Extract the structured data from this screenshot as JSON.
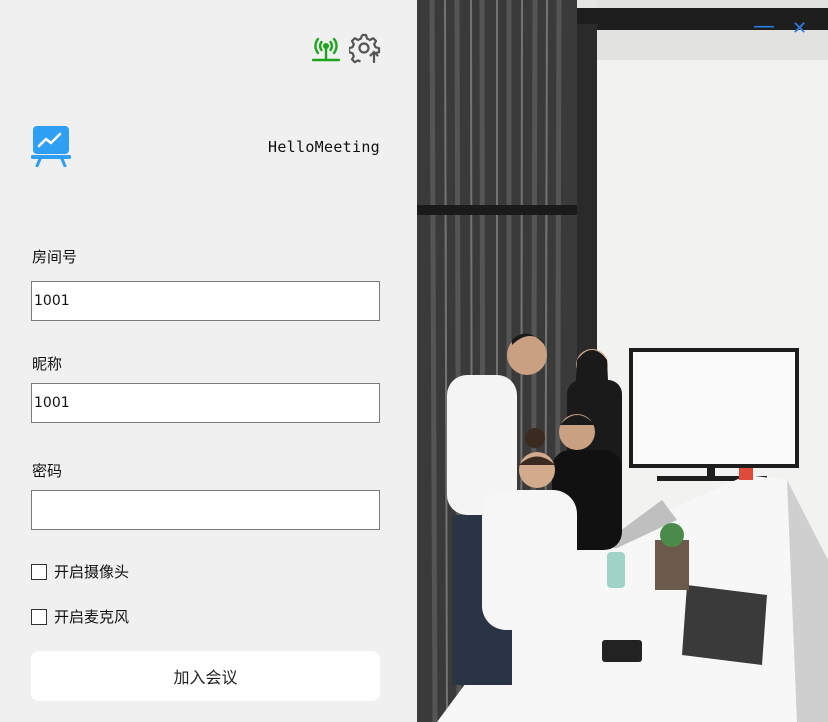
{
  "app": {
    "title": "HelloMeeting"
  },
  "form": {
    "room_label": "房间号",
    "room_value": "1001",
    "nickname_label": "昵称",
    "nickname_value": "1001",
    "password_label": "密码",
    "password_value": "",
    "camera_label": "开启摄像头",
    "camera_checked": false,
    "mic_label": "开启麦克风",
    "mic_checked": false,
    "join_label": "加入会议"
  },
  "window_controls": {
    "minimize": "—",
    "close": "✕"
  },
  "icons": {
    "network": "network-status-icon",
    "settings": "settings-upload-icon",
    "logo": "presentation-chart-icon"
  },
  "colors": {
    "network_icon": "#1aa51a",
    "logo": "#2e9ff2",
    "window_controls": "#2a7de1"
  }
}
